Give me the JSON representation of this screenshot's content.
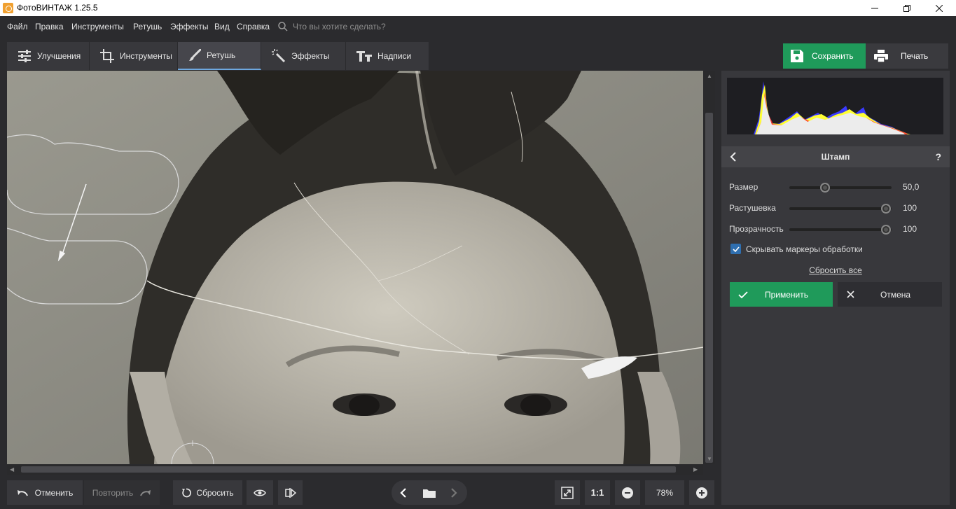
{
  "window": {
    "title": "ФотоВИНТАЖ 1.25.5"
  },
  "menu": {
    "items": [
      "Файл",
      "Правка",
      "Инструменты",
      "Ретушь",
      "Эффекты",
      "Вид",
      "Справка"
    ],
    "search_placeholder": "Что вы хотите сделать?"
  },
  "tabs": [
    {
      "label": "Улучшения",
      "icon": "sliders-icon"
    },
    {
      "label": "Инструменты",
      "icon": "crop-icon"
    },
    {
      "label": "Ретушь",
      "icon": "brush-icon",
      "active": true
    },
    {
      "label": "Эффекты",
      "icon": "magic-wand-icon"
    },
    {
      "label": "Надписи",
      "icon": "text-icon"
    }
  ],
  "toolbar": {
    "save_label": "Сохранить",
    "print_label": "Печать"
  },
  "panel": {
    "title": "Штамп",
    "help": "?",
    "sliders": [
      {
        "label": "Размер",
        "value": "50,0",
        "fraction": 0.34
      },
      {
        "label": "Растушевка",
        "value": "100",
        "fraction": 1.0
      },
      {
        "label": "Прозрачность",
        "value": "100",
        "fraction": 1.0
      }
    ],
    "checkbox_label": "Скрывать маркеры обработки",
    "checkbox_checked": true,
    "reset_all": "Сбросить все",
    "apply_label": "Применить",
    "cancel_label": "Отмена"
  },
  "bottom": {
    "undo_label": "Отменить",
    "redo_label": "Повторить",
    "reset_label": "Сбросить",
    "zoom_ratio": "1:1",
    "zoom_value": "78%"
  },
  "colors": {
    "accent_green": "#1f9a5a",
    "active_tab_underline": "#6ea8e0",
    "checkbox": "#2f6fb0"
  }
}
